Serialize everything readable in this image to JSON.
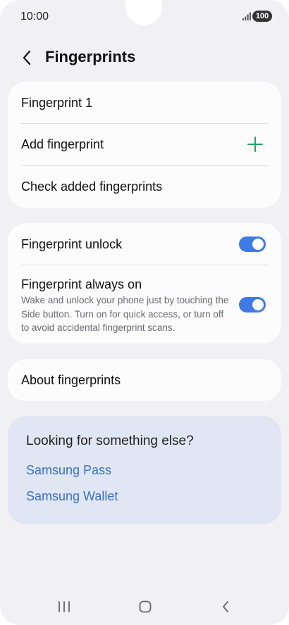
{
  "status": {
    "time": "10:00",
    "battery": "100"
  },
  "header": {
    "title": "Fingerprints",
    "back_icon": "chevron-left-icon"
  },
  "fingerprints_card": {
    "items": [
      {
        "label": "Fingerprint 1"
      },
      {
        "label": "Add fingerprint",
        "icon": "plus-icon",
        "icon_color": "#2e9e6a"
      },
      {
        "label": "Check added fingerprints"
      }
    ]
  },
  "settings_card": {
    "unlock": {
      "label": "Fingerprint unlock",
      "enabled": true
    },
    "always_on": {
      "label": "Fingerprint always on",
      "description": "Wake and unlock your phone just by touching the Side button. Turn on for quick access, or turn off to avoid accidental fingerprint scans.",
      "enabled": true
    },
    "toggle_color": "#3f7be4"
  },
  "about_card": {
    "label": "About fingerprints"
  },
  "suggestions": {
    "title": "Looking for something else?",
    "links": [
      {
        "label": "Samsung Pass"
      },
      {
        "label": "Samsung Wallet"
      }
    ],
    "link_color": "#3a6fc4"
  },
  "nav": {
    "recents_icon": "recents-icon",
    "home_icon": "home-icon",
    "back_icon": "back-icon"
  }
}
